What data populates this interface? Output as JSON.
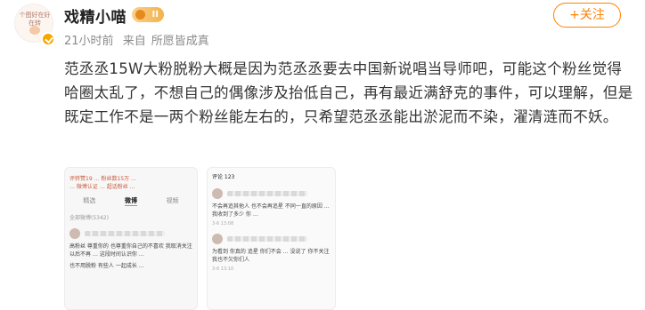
{
  "post": {
    "username": "戏精小喵",
    "level_badge": "II",
    "time": "21小时前",
    "source_prefix": "来自",
    "source": "所愿皆成真",
    "text": "范丞丞15W大粉脱粉大概是因为范丞丞要去中国新说唱当导师吧，可能这个粉丝觉得哈圈太乱了，不想自己的偶像涉及抬低自己，再有最近满舒克的事件，可以理解，但是既定工作不是一两个粉丝能左右的，只希望范丞丞能出淤泥而不染，濯清涟而不妖。"
  },
  "follow_button": {
    "label": "+关注"
  },
  "avatar": {
    "scribble": "个图好在好在转"
  },
  "screenshot1": {
    "lines": [
      "评转赞19 … 粉丝数15万 …",
      "… 微博认证 … 超话粉丝 …"
    ],
    "tabs": [
      "精选",
      "微博",
      "视频"
    ],
    "small": "全部微博(5342)",
    "comment": "高粉丝 尊重你的 也尊重你自己的不喜欢 我取消关注 以后不再 … 这段时间认识你 …",
    "comment2": "也不用脱粉 有些人 一起成长 …"
  },
  "screenshot2": {
    "header": "评论 123",
    "comment1": "不会再追其他人 也不会再追星 不同一直的原因 … 我收到了多少 你 …",
    "comment1_time": "3-6 13:08",
    "comment2": "为看到 你真的 追星 你们不会 … 没说了 你不关注 我也不欠你们人",
    "comment2_time": "3-6 13:10"
  }
}
